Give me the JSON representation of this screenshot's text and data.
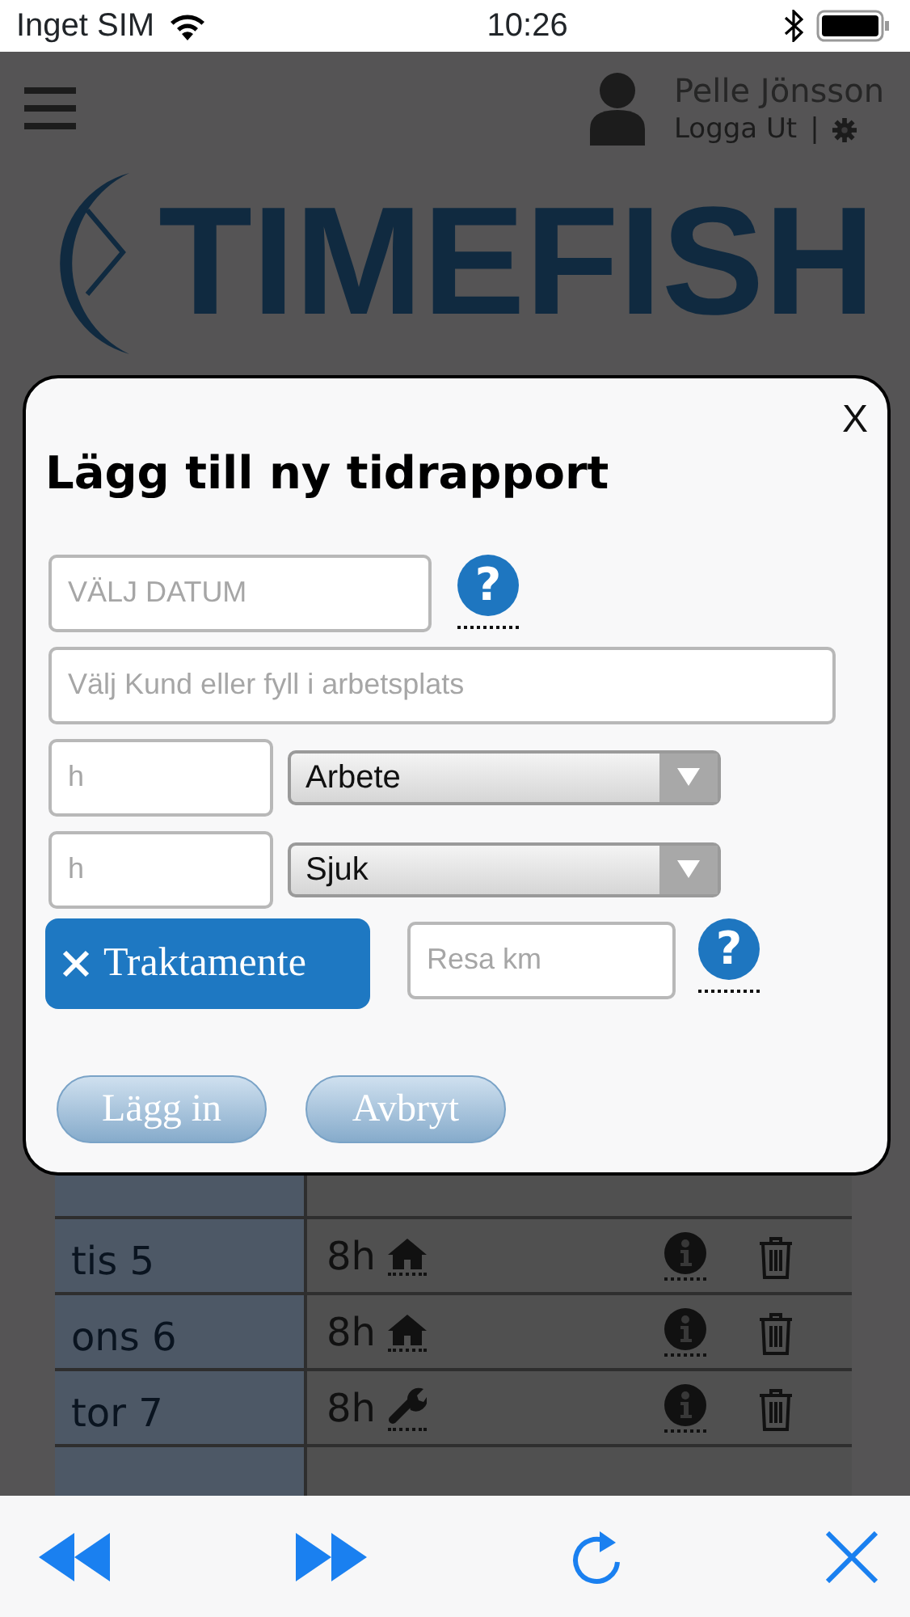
{
  "status_bar": {
    "carrier": "Inget SIM",
    "time": "10:26"
  },
  "header": {
    "user_name": "Pelle Jönsson",
    "logout": "Logga Ut",
    "separator": "|"
  },
  "logo": {
    "text": "TIMEFISH"
  },
  "table": {
    "rows": [
      {
        "kind": "blank"
      },
      {
        "kind": "home",
        "day": "tis 5",
        "hours": "8h"
      },
      {
        "kind": "home",
        "day": "ons 6",
        "hours": "8h"
      },
      {
        "kind": "tool",
        "day": "tor 7",
        "hours": "8h"
      },
      {
        "kind": "blank"
      }
    ]
  },
  "modal": {
    "close": "X",
    "title": "Lägg till ny tidrapport",
    "date": {
      "placeholder": "VÄLJ DATUM",
      "help": "?"
    },
    "customer": {
      "placeholder": "Välj Kund eller fyll i arbetsplats"
    },
    "hour_rows": [
      {
        "placeholder": "h",
        "type": "Arbete"
      },
      {
        "placeholder": "h",
        "type": "Sjuk"
      }
    ],
    "allowance": {
      "label": "Traktamente"
    },
    "distance": {
      "placeholder": "Resa km",
      "help": "?"
    },
    "buttons": [
      "Lägg in",
      "Avbryt"
    ]
  }
}
